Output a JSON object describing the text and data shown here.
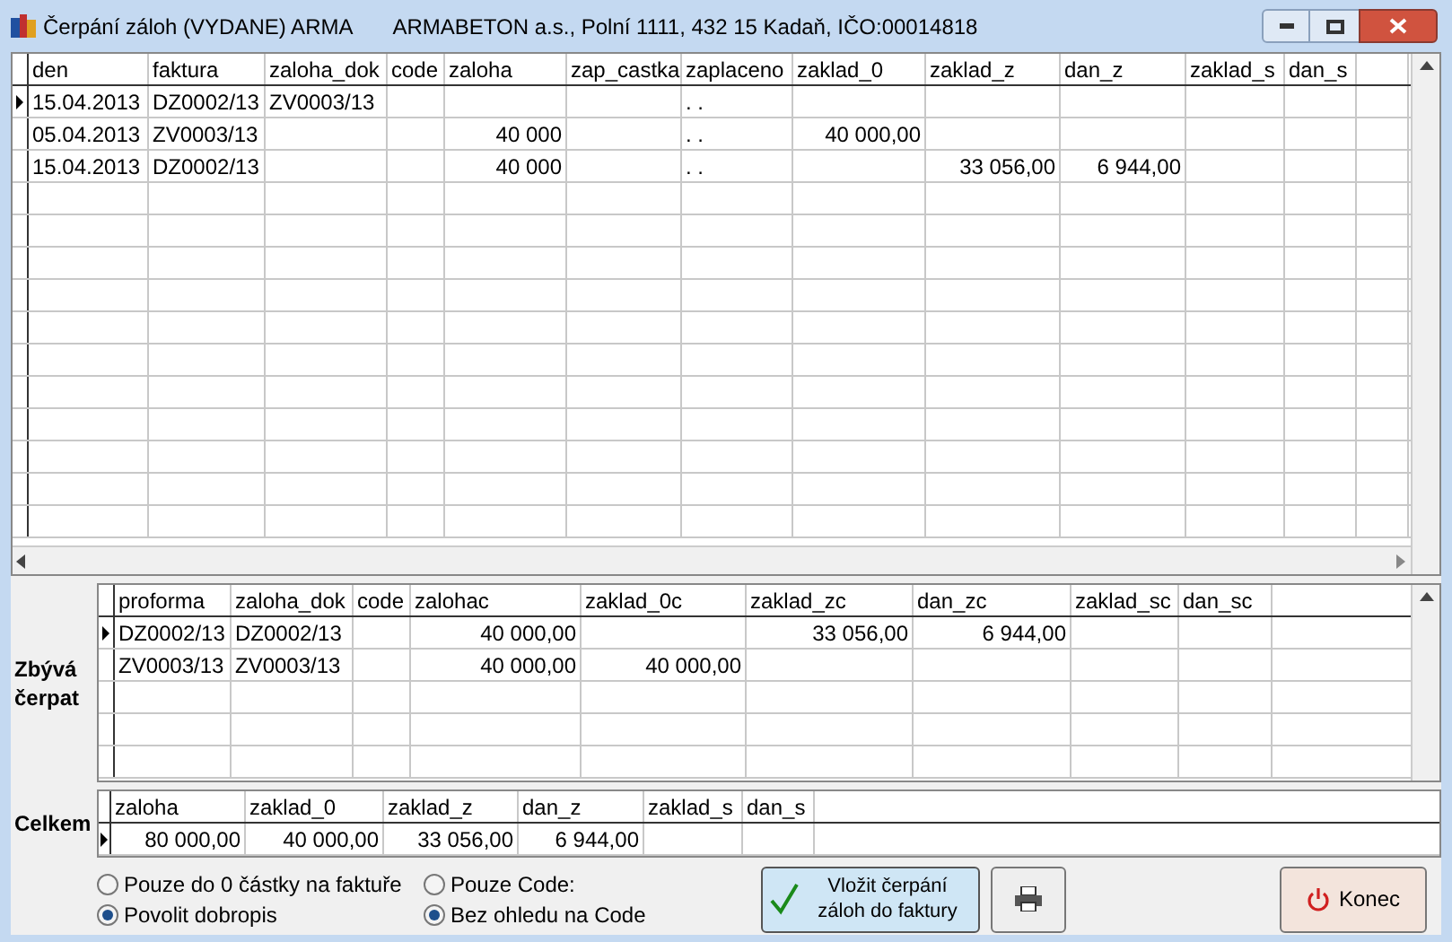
{
  "window": {
    "title": "Čerpání záloh (VYDANE) ARMA",
    "subtitle": "ARMABETON a.s., Polní 1111, 432 15 Kadaň, IČO:00014818"
  },
  "main_grid": {
    "columns": [
      "den",
      "faktura",
      "zaloha_dok",
      "code",
      "zaloha",
      "zap_castka",
      "zaplaceno",
      "zaklad_0",
      "zaklad_z",
      "dan_z",
      "zaklad_s",
      "dan_s"
    ],
    "rows": [
      {
        "current": true,
        "cells": [
          "15.04.2013",
          "DZ0002/13",
          "ZV0003/13",
          "",
          "",
          "",
          ". .",
          "",
          "",
          "",
          "",
          ""
        ]
      },
      {
        "current": false,
        "cells": [
          "05.04.2013",
          "ZV0003/13",
          "",
          "",
          "40 000",
          "",
          ". .",
          "40 000,00",
          "",
          "",
          "",
          ""
        ]
      },
      {
        "current": false,
        "cells": [
          "15.04.2013",
          "DZ0002/13",
          "",
          "",
          "40 000",
          "",
          ". .",
          "",
          "33 056,00",
          "6 944,00",
          "",
          ""
        ]
      }
    ]
  },
  "remaining": {
    "label": "Zbývá čerpat",
    "columns": [
      "proforma",
      "zaloha_dok",
      "code",
      "zalohac",
      "zaklad_0c",
      "zaklad_zc",
      "dan_zc",
      "zaklad_sc",
      "dan_sc"
    ],
    "rows": [
      {
        "current": true,
        "cells": [
          "DZ0002/13",
          "DZ0002/13",
          "",
          "40 000,00",
          "",
          "33 056,00",
          "6 944,00",
          "",
          ""
        ]
      },
      {
        "current": false,
        "cells": [
          "ZV0003/13",
          "ZV0003/13",
          "",
          "40 000,00",
          "40 000,00",
          "",
          "",
          "",
          ""
        ]
      }
    ]
  },
  "totals": {
    "label": "Celkem",
    "columns": [
      "zaloha",
      "zaklad_0",
      "zaklad_z",
      "dan_z",
      "zaklad_s",
      "dan_s"
    ],
    "rows": [
      {
        "current": true,
        "cells": [
          "80 000,00",
          "40 000,00",
          "33 056,00",
          "6 944,00",
          "",
          ""
        ]
      }
    ]
  },
  "options_1": [
    {
      "label": "Pouze do 0 částky na faktuře",
      "selected": false
    },
    {
      "label": "Povolit dobropis",
      "selected": true
    }
  ],
  "options_2": [
    {
      "label": "Pouze Code:",
      "selected": false
    },
    {
      "label": "Bez ohledu na Code",
      "selected": true
    }
  ],
  "buttons": [
    {
      "kind": "insert",
      "label": "Vložit čerpání záloh do faktury"
    },
    {
      "kind": "print"
    },
    {
      "kind": "close",
      "label": "Konec"
    }
  ]
}
